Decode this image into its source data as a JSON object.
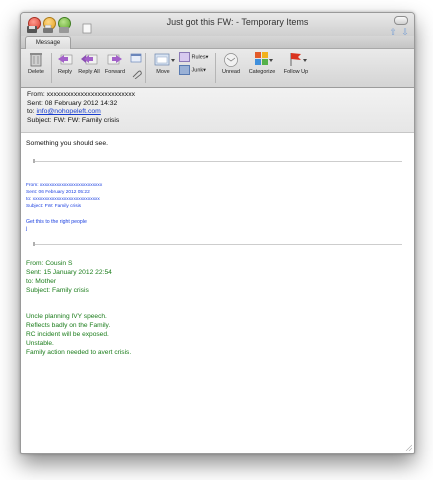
{
  "window": {
    "title": "Just got this FW: - Temporary Items"
  },
  "tabs": {
    "message": "Message"
  },
  "toolbar": {
    "delete": "Delete",
    "reply": "Reply",
    "reply_all": "Reply All",
    "forward": "Forward",
    "move": "Move",
    "rules": "Rules",
    "junk": "Junk",
    "unread": "Unread",
    "categorize": "Categorize",
    "follow_up": "Follow Up"
  },
  "header": {
    "from_label": "From:",
    "from_value": "xxxxxxxxxxxxxxxxxxxxxxxxxx",
    "sent_label": "Sent:",
    "sent_value": "08 February 2012 14:32",
    "to_label": "to:",
    "to_value": "info@nohopeleft.com",
    "subject_label": "Subject:",
    "subject_value": "FW: FW: Family crisis"
  },
  "body": {
    "intro": "Something you should see.",
    "fw1": {
      "from": "From: xxxxxxxxxxxxxxxxxxxxxxxxxx",
      "sent": "Sent:  06 February 2012 05:22",
      "to": "to:  xxxxxxxxxxxxxxxxxxxxxxxxxxxx",
      "subject": "Subject: FW: Family crisis",
      "message": "Get this to the right people",
      "extra": "j"
    },
    "fw2": {
      "from": "From:   Cousin S",
      "sent": "Sent:  15 January 2012 22:54",
      "to": "to:   Mother",
      "subject": "Subject: Family crisis",
      "lines": [
        "Uncle planning IVY speech.",
        "Reflects badly on the Family.",
        "RC incident will be exposed.",
        "Unstable.",
        "Family action needed to avert crisis."
      ]
    }
  },
  "colors": {
    "link_blue": "#1a3fcf",
    "forward_blue": "#1a3fe0",
    "original_green": "#1b7d1b"
  },
  "icons": [
    "delete-icon",
    "reply-icon",
    "reply-all-icon",
    "forward-icon",
    "move-icon",
    "rules-icon",
    "junk-icon",
    "unread-icon",
    "categorize-icon",
    "follow-up-icon"
  ]
}
